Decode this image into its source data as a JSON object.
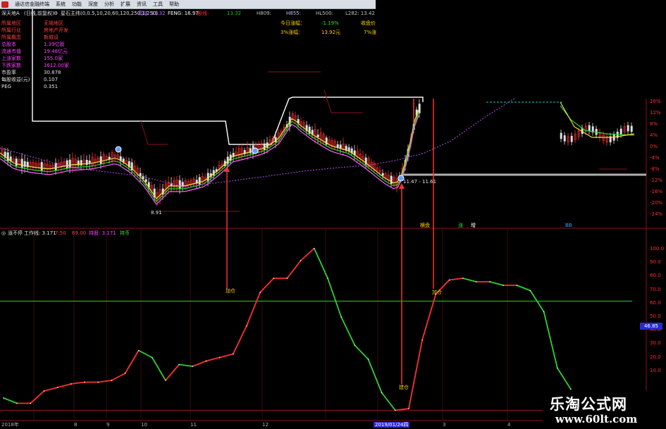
{
  "app": {
    "title": "通达信金融终端",
    "menu": [
      "系统",
      "功能",
      "深度",
      "分析",
      "扩展",
      "资讯",
      "工具",
      "帮助"
    ]
  },
  "main_header": {
    "stock": "深天地A",
    "period": "(日线,前复权)",
    "indicator": "星石主纬(0,0.5,10,20,60,120,250,1,250)",
    "readouts": [
      {
        "label": "高纬",
        "value": "13.32",
        "color": "#c070ff"
      },
      {
        "label": "FENG",
        "value": "16.97",
        "color": "#ffffff"
      },
      {
        "label": "股线",
        "value": "",
        "color": "#ff3333"
      },
      {
        "label": "",
        "value": "13.32",
        "color": "#20c020"
      },
      {
        "label": "H809",
        "value": "",
        "color": "#c0c0c0"
      },
      {
        "label": "H855",
        "value": "",
        "color": "#c0c0ff"
      },
      {
        "label": "HL500",
        "value": "",
        "color": "#c0c0c0"
      },
      {
        "label": "L282",
        "value": "13.42",
        "color": "#c0c0c0"
      }
    ]
  },
  "info_panel": [
    {
      "label": "所属地区",
      "value": "无锡地区",
      "lcolor": "#ff4040",
      "vcolor": "#ff4040"
    },
    {
      "label": "所属行业",
      "value": "房地产开发",
      "lcolor": "#ff4040",
      "vcolor": "#ff4040"
    },
    {
      "label": "所属概念",
      "value": "新城设",
      "lcolor": "#ff4040",
      "vcolor": "#ff4040"
    },
    {
      "label": "总股本",
      "value": "1.39亿股",
      "lcolor": "#ff40ff",
      "vcolor": "#ff40ff"
    },
    {
      "label": "流通市值",
      "value": "19.48亿元",
      "lcolor": "#ff40ff",
      "vcolor": "#ff40ff"
    },
    {
      "label": "上涨家数",
      "value": "155.0家",
      "lcolor": "#ff40ff",
      "vcolor": "#ff40ff"
    },
    {
      "label": "下跌家数",
      "value": "1612.00家",
      "lcolor": "#ff40ff",
      "vcolor": "#ff40ff"
    },
    {
      "label": "市盈率",
      "value": "30.878",
      "lcolor": "#e0e0e0",
      "vcolor": "#e0e0e0"
    },
    {
      "label": "每股收益(元)",
      "value": "0.107",
      "lcolor": "#e0e0e0",
      "vcolor": "#e0e0e0"
    },
    {
      "label": "PEG",
      "value": "0.351",
      "lcolor": "#e0e0e0",
      "vcolor": "#e0e0e0"
    }
  ],
  "quote_box": {
    "today_change_label": "今日涨幅：",
    "today_change": "-1.19%",
    "pct3_label": "3%涨幅：",
    "pct3_value": "13.92元",
    "close_label": "收盘价",
    "close_pct": "7%涨"
  },
  "price_axis": [
    "16%",
    "12%",
    "8%",
    "4%",
    "0%",
    "-4%",
    "-8%",
    "-12%",
    "-16%",
    "-20%",
    "-24%"
  ],
  "main_annotations": {
    "low_mark": "8.91",
    "point_mark": "11.47 - 11.61",
    "tags": [
      {
        "text": "横盘",
        "color": "#ffd000"
      },
      {
        "text": "涨",
        "color": "#30e030"
      },
      {
        "text": "增",
        "color": "#ffffff"
      },
      {
        "text": "BB",
        "color": "#40a0ff"
      }
    ]
  },
  "sub_header": {
    "name": "涨不停",
    "line": "工作线: 3.171",
    "items": [
      {
        "text": "7:50",
        "color": "#ff4040"
      },
      {
        "text": "69.00",
        "color": "#ff4040"
      },
      {
        "text": "持股: 3.171",
        "color": "#ff40ff"
      },
      {
        "text": "持币",
        "color": "#30e030"
      }
    ]
  },
  "sub_axis": [
    "100.0",
    "90.0",
    "80.0",
    "70.0",
    "60.0",
    "50.0",
    "40.0",
    "30.0",
    "20.0",
    "10.0"
  ],
  "sub_signals": [
    "加仓",
    "加仓",
    "建仓"
  ],
  "current_value_badge": "46.85",
  "date_axis": {
    "labels": [
      "2018年",
      "8",
      "9",
      "10",
      "11",
      "12",
      "2019/01/24四",
      "3",
      "4"
    ]
  },
  "watermark": {
    "line1": "乐淘公式网",
    "line2": "www.60lt.com"
  },
  "chart_data": {
    "type": "line",
    "series": [
      {
        "values": [
          15,
          12,
          12,
          19,
          21,
          23,
          24,
          24,
          25,
          29,
          42,
          38,
          25,
          34,
          33,
          36,
          38,
          40,
          56,
          75,
          83,
          83,
          93,
          100,
          83,
          61,
          45,
          37,
          18,
          8,
          9,
          48,
          74,
          82,
          83,
          81,
          81,
          79,
          79,
          76,
          64,
          32,
          20
        ]
      }
    ],
    "ylim": [
      5,
      105
    ],
    "reference_lines": [
      70,
      8
    ],
    "grid": false
  },
  "colors": {
    "rise": "#ff3030",
    "fall": "#30d030",
    "border": "#8a1020",
    "accent": "#2a2ad0"
  }
}
